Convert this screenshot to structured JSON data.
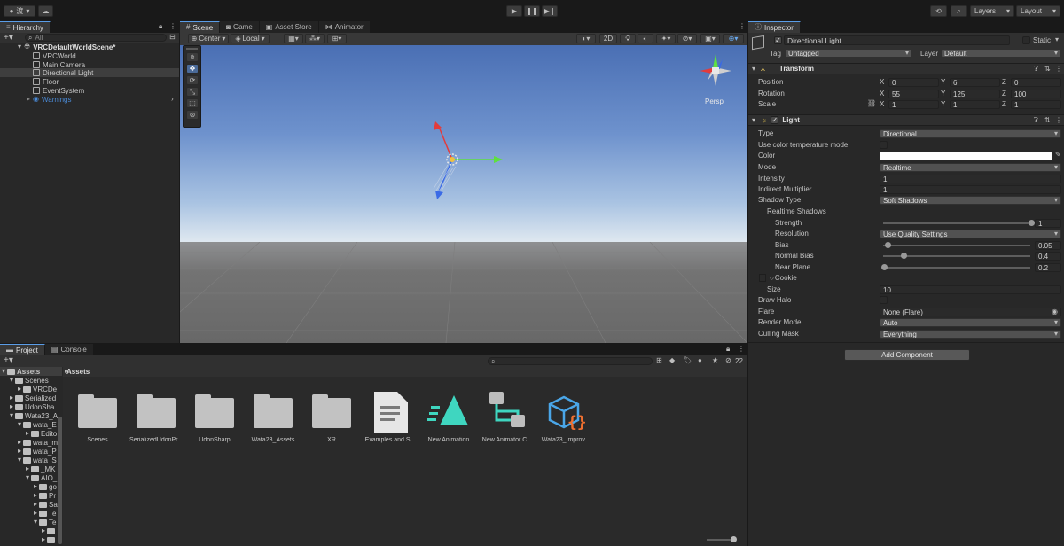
{
  "toolbar": {
    "account": "渡",
    "layers": "Layers",
    "layout": "Layout"
  },
  "hierarchy": {
    "tab": "Hierarchy",
    "search_placeholder": "All",
    "scene": "VRCDefaultWorldScene*",
    "items": [
      "VRCWorld",
      "Main Camera",
      "Directional Light",
      "Floor",
      "EventSystem"
    ],
    "warnings": "Warnings"
  },
  "scene_tabs": [
    "Scene",
    "Game",
    "Asset Store",
    "Animator"
  ],
  "scene_toolbar": {
    "pivot": "Center",
    "space": "Local",
    "view_mode": "2D",
    "persp": "Persp"
  },
  "project": {
    "tabs": [
      "Project",
      "Console"
    ],
    "breadcrumb": "Assets",
    "hidden_count": "22",
    "tree": [
      {
        "label": "Assets",
        "indent": 0
      },
      {
        "label": "Scenes",
        "indent": 1
      },
      {
        "label": "VRCDe",
        "indent": 2
      },
      {
        "label": "Serialized",
        "indent": 1
      },
      {
        "label": "UdonSha",
        "indent": 1
      },
      {
        "label": "Wata23_A",
        "indent": 1
      },
      {
        "label": "wata_E",
        "indent": 2
      },
      {
        "label": "Edito",
        "indent": 3
      },
      {
        "label": "wata_m",
        "indent": 2
      },
      {
        "label": "wata_P",
        "indent": 2
      },
      {
        "label": "wata_S",
        "indent": 2
      },
      {
        "label": "_MK",
        "indent": 3
      },
      {
        "label": "AIO_",
        "indent": 3
      },
      {
        "label": "go",
        "indent": 4
      },
      {
        "label": "Pr",
        "indent": 4
      },
      {
        "label": "Sa",
        "indent": 4
      },
      {
        "label": "Te",
        "indent": 4
      },
      {
        "label": "Te",
        "indent": 4
      },
      {
        "label": "",
        "indent": 5
      },
      {
        "label": "",
        "indent": 5
      }
    ],
    "assets": [
      {
        "name": "Scenes",
        "icon": "folder-icon"
      },
      {
        "name": "SerializedUdonPr...",
        "icon": "folder-icon"
      },
      {
        "name": "UdonSharp",
        "icon": "folder-icon"
      },
      {
        "name": "Wata23_Assets",
        "icon": "folder-icon"
      },
      {
        "name": "XR",
        "icon": "folder-icon"
      },
      {
        "name": "Examples and S...",
        "icon": "document-icon"
      },
      {
        "name": "New Animation",
        "icon": "animation-icon"
      },
      {
        "name": "New Animator C...",
        "icon": "animator-controller-icon"
      },
      {
        "name": "Wata23_Improv...",
        "icon": "script-icon"
      }
    ]
  },
  "inspector": {
    "tab": "Inspector",
    "object_name": "Directional Light",
    "static_label": "Static",
    "tag_label": "Tag",
    "tag_value": "Untagged",
    "layer_label": "Layer",
    "layer_value": "Default",
    "transform": {
      "title": "Transform",
      "position_label": "Position",
      "rotation_label": "Rotation",
      "scale_label": "Scale",
      "position": {
        "x": "0",
        "y": "6",
        "z": "0"
      },
      "rotation": {
        "x": "55",
        "y": "125",
        "z": "100"
      },
      "scale": {
        "x": "1",
        "y": "1",
        "z": "1"
      }
    },
    "light": {
      "title": "Light",
      "type_label": "Type",
      "type_value": "Directional",
      "color_temp_label": "Use color temperature mode",
      "color_label": "Color",
      "color_value": "#ffffff",
      "mode_label": "Mode",
      "mode_value": "Realtime",
      "intensity_label": "Intensity",
      "intensity_value": "1",
      "indirect_label": "Indirect Multiplier",
      "indirect_value": "1",
      "shadow_type_label": "Shadow Type",
      "shadow_type_value": "Soft Shadows",
      "realtime_shadows_label": "Realtime Shadows",
      "strength_label": "Strength",
      "strength_value": "1",
      "strength_fraction": 1.0,
      "resolution_label": "Resolution",
      "resolution_value": "Use Quality Settings",
      "bias_label": "Bias",
      "bias_value": "0.05",
      "bias_fraction": 0.025,
      "normal_bias_label": "Normal Bias",
      "normal_bias_value": "0.4",
      "normal_bias_fraction": 0.133,
      "near_plane_label": "Near Plane",
      "near_plane_value": "0.2",
      "near_plane_fraction": 0.0,
      "cookie_label": "Cookie",
      "size_label": "Size",
      "size_value": "10",
      "draw_halo_label": "Draw Halo",
      "flare_label": "Flare",
      "flare_value": "None (Flare)",
      "render_mode_label": "Render Mode",
      "render_mode_value": "Auto",
      "culling_mask_label": "Culling Mask",
      "culling_mask_value": "Everything"
    },
    "add_component": "Add Component"
  },
  "colors": {
    "accent": "#5a9de8",
    "sky_top": "#4a6fb4",
    "sky_bottom": "#dfe8f0",
    "ground": "#6b6b6b",
    "axis_x": "#e33b3b",
    "axis_y": "#5ee040",
    "axis_z": "#3a6ae6"
  }
}
